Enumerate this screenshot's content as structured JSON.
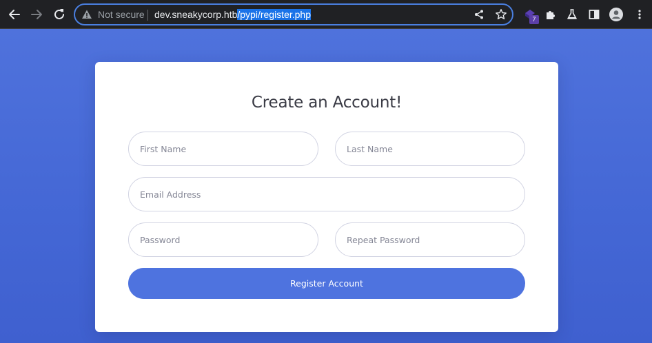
{
  "browser": {
    "omnibox": {
      "security_label": "Not secure",
      "url_host": "dev.sneakycorp.htb",
      "url_path_selected": "/pypi/register.php"
    },
    "extension_badge": "7",
    "icons": [
      "back-icon",
      "forward-icon",
      "reload-icon",
      "warning-icon",
      "share-icon",
      "star-icon",
      "extension-icon",
      "puzzle-icon",
      "labs-flask-icon",
      "side-panel-icon",
      "profile-icon",
      "menu-icon"
    ]
  },
  "form": {
    "title": "Create an Account!",
    "first_name_placeholder": "First Name",
    "last_name_placeholder": "Last Name",
    "email_placeholder": "Email Address",
    "password_placeholder": "Password",
    "repeat_password_placeholder": "Repeat Password",
    "submit_label": "Register Account"
  },
  "colors": {
    "background": "#4669d6",
    "button": "#4e73df",
    "card": "#ffffff",
    "selection": "#1a73e8"
  }
}
